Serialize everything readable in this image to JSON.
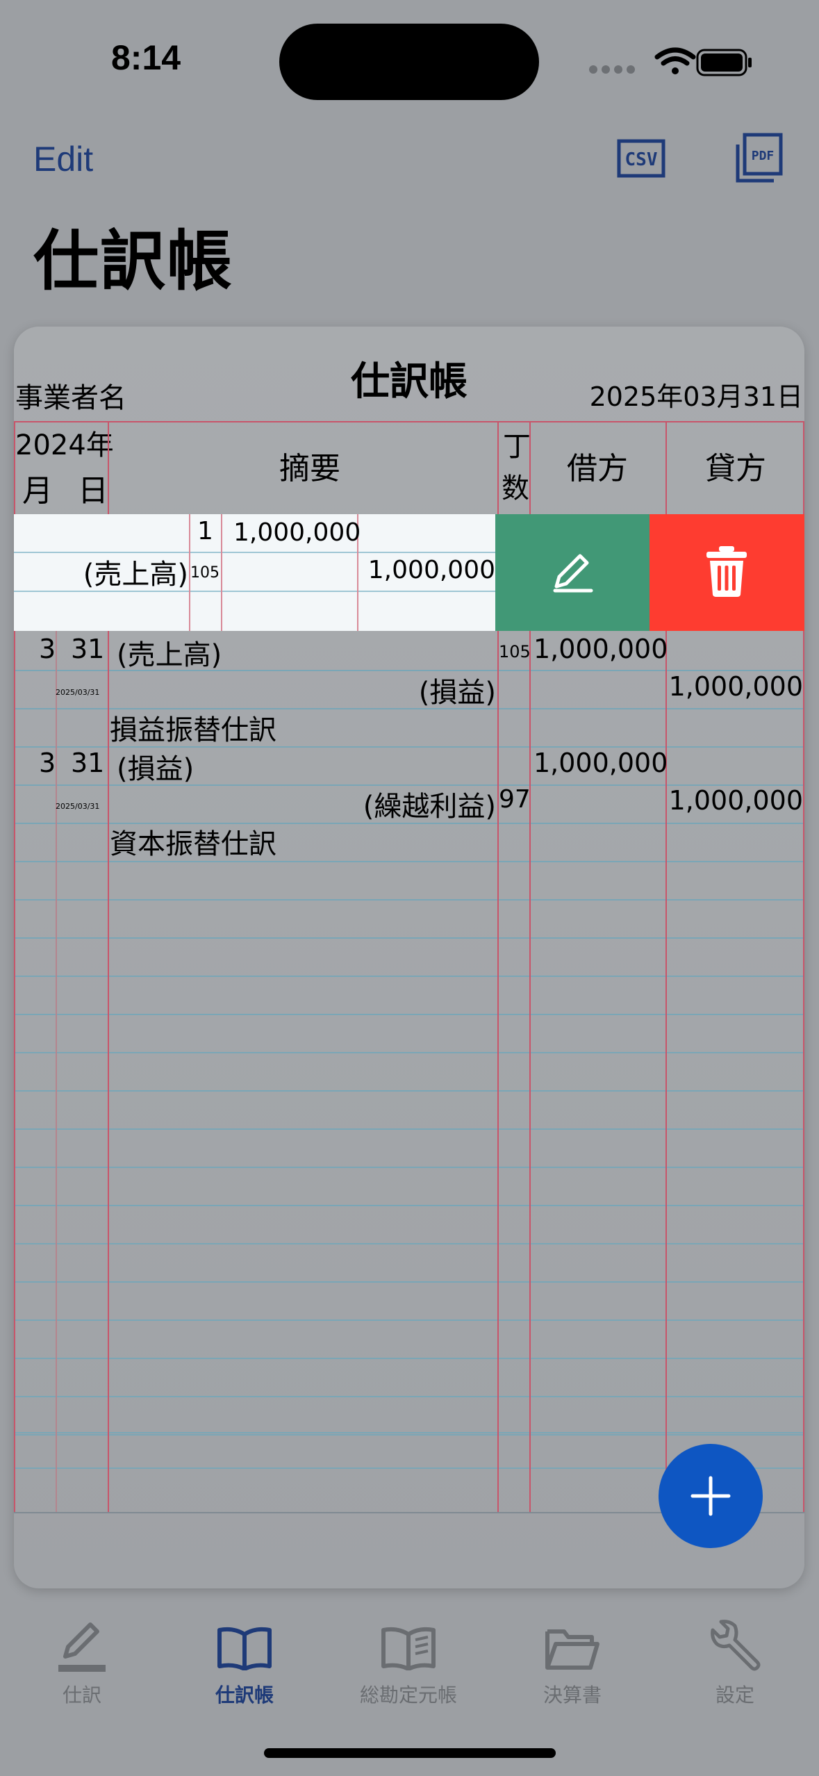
{
  "status": {
    "time": "8:14"
  },
  "nav": {
    "edit_label": "Edit",
    "csv_label": "CSV",
    "pdf_label": "PDF"
  },
  "page_title": "仕訳帳",
  "journal": {
    "title": "仕訳帳",
    "business_name": "事業者名",
    "period_end": "2025年03月31日",
    "headers": {
      "year": "2024年",
      "month": "月",
      "day": "日",
      "description": "摘要",
      "folio_top": "丁",
      "folio_bottom": "数",
      "debit": "借方",
      "credit": "貸方"
    },
    "swiped_entry": {
      "folio_top": "1",
      "debit_amount": "1,000,000",
      "credit_account": "(売上高)",
      "credit_folio": "105",
      "credit_amount": "1,000,000"
    },
    "entries": [
      {
        "month": "3",
        "day": "31",
        "debit_account": "(売上高)",
        "debit_folio": "105",
        "debit_amount": "1,000,000",
        "date_small": "2025/03/31",
        "credit_account": "(損益)",
        "credit_folio": "",
        "credit_amount": "1,000,000",
        "memo": "損益振替仕訳"
      },
      {
        "month": "3",
        "day": "31",
        "debit_account": "(損益)",
        "debit_folio": "",
        "debit_amount": "1,000,000",
        "date_small": "2025/03/31",
        "credit_account": "(繰越利益)",
        "credit_folio": "97",
        "credit_amount": "1,000,000",
        "memo": "資本振替仕訳"
      }
    ]
  },
  "swipe_actions": {
    "edit_icon": "pencil-icon",
    "delete_icon": "trash-icon"
  },
  "tabs": [
    {
      "label": "仕訳",
      "icon": "pencil-icon",
      "active": false
    },
    {
      "label": "仕訳帳",
      "icon": "book-icon",
      "active": true
    },
    {
      "label": "総勘定元帳",
      "icon": "open-book-icon",
      "active": false
    },
    {
      "label": "決算書",
      "icon": "folder-icon",
      "active": false
    },
    {
      "label": "設定",
      "icon": "wrench-icon",
      "active": false
    }
  ],
  "colors": {
    "accent": "#1e3a78",
    "edit_action": "#419876",
    "delete_action": "#fe3c30",
    "fab": "#0e56c2",
    "ruled_red": "#c8556a",
    "ruled_blue": "#7aa6b6"
  }
}
